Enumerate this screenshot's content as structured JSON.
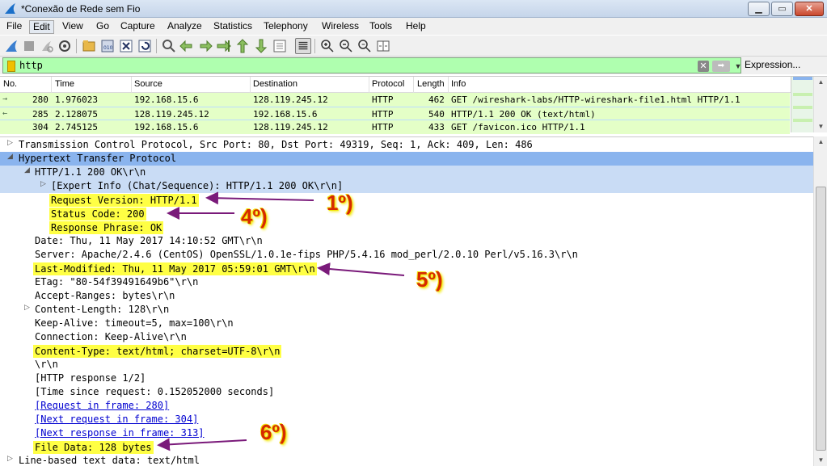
{
  "window": {
    "title": "*Conexão de Rede sem Fio",
    "minimize": "▁",
    "maximize": "▭",
    "close": "✕"
  },
  "menu": [
    "File",
    "Edit",
    "View",
    "Go",
    "Capture",
    "Analyze",
    "Statistics",
    "Telephony",
    "Wireless",
    "Tools",
    "Help"
  ],
  "menu_active": "Edit",
  "filter": {
    "value": "http",
    "expression_label": "Expression..."
  },
  "packet_list": {
    "columns": [
      "No.",
      "Time",
      "Source",
      "Destination",
      "Protocol",
      "Length",
      "Info"
    ],
    "rows": [
      {
        "no": "280",
        "time": "1.976023",
        "source": "192.168.15.6",
        "destination": "128.119.245.12",
        "protocol": "HTTP",
        "length": "462",
        "info": "GET /wireshark-labs/HTTP-wireshark-file1.html HTTP/1.1"
      },
      {
        "no": "285",
        "time": "2.128075",
        "source": "128.119.245.12",
        "destination": "192.168.15.6",
        "protocol": "HTTP",
        "length": "540",
        "info": "HTTP/1.1 200 OK  (text/html)"
      },
      {
        "no": "304",
        "time": "2.745125",
        "source": "192.168.15.6",
        "destination": "128.119.245.12",
        "protocol": "HTTP",
        "length": "433",
        "info": "GET /favicon.ico HTTP/1.1"
      }
    ]
  },
  "details": {
    "tcp": "Transmission Control Protocol, Src Port: 80, Dst Port: 49319, Seq: 1, Ack: 409, Len: 486",
    "http": "Hypertext Transfer Protocol",
    "status_line": "HTTP/1.1 200 OK\\r\\n",
    "expert_info": "[Expert Info (Chat/Sequence): HTTP/1.1 200 OK\\r\\n]",
    "request_version": "Request Version: HTTP/1.1",
    "status_code": "Status Code: 200",
    "response_phrase": "Response Phrase: OK",
    "date": "Date: Thu, 11 May 2017 14:10:52 GMT\\r\\n",
    "server": "Server: Apache/2.4.6 (CentOS) OpenSSL/1.0.1e-fips PHP/5.4.16 mod_perl/2.0.10 Perl/v5.16.3\\r\\n",
    "last_modified": "Last-Modified: Thu, 11 May 2017 05:59:01 GMT\\r\\n",
    "etag": "ETag: \"80-54f39491649b6\"\\r\\n",
    "accept_ranges": "Accept-Ranges: bytes\\r\\n",
    "content_length": "Content-Length: 128\\r\\n",
    "keep_alive": "Keep-Alive: timeout=5, max=100\\r\\n",
    "connection": "Connection: Keep-Alive\\r\\n",
    "content_type": "Content-Type: text/html; charset=UTF-8\\r\\n",
    "crlf": "\\r\\n",
    "http_response": "[HTTP response 1/2]",
    "time_since": "[Time since request: 0.152052000 seconds]",
    "request_in_frame": "[Request in frame: 280]",
    "next_request": "[Next request in frame: 304]",
    "next_response": "[Next response in frame: 313]",
    "file_data": "File Data: 128 bytes",
    "line_based": "Line-based text data: text/html"
  },
  "annotations": [
    "1º)",
    "4º)",
    "5º)",
    "6º)"
  ],
  "colors": {
    "http_row": "#e4ffc7",
    "selected": "#8ab4ee",
    "filter_bg": "#afffaf",
    "highlight": "#ffff44",
    "annotation": "#d62a00",
    "arrow": "#7a1a7a"
  }
}
